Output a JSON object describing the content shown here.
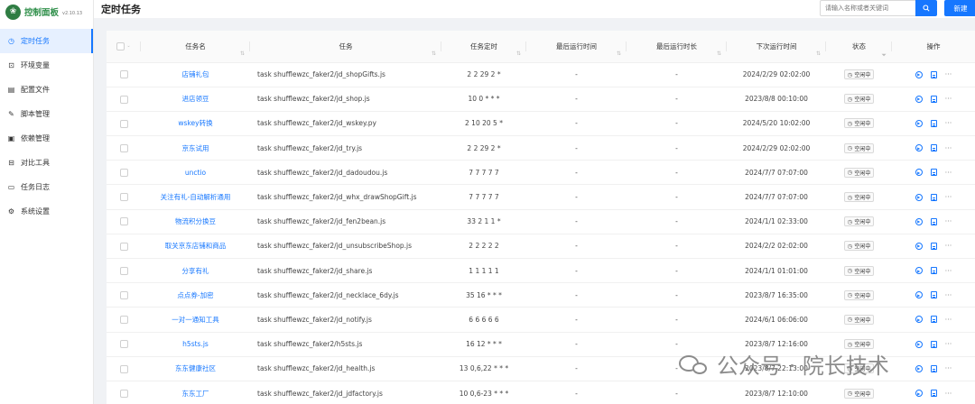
{
  "app": {
    "logo_text": "控制面板",
    "version": "v2.10.13"
  },
  "sidebar": {
    "items": [
      {
        "label": "定时任务",
        "icon": "clock-icon",
        "active": true
      },
      {
        "label": "环境变量",
        "icon": "variable-icon",
        "active": false
      },
      {
        "label": "配置文件",
        "icon": "config-file-icon",
        "active": false
      },
      {
        "label": "脚本管理",
        "icon": "edit-icon",
        "active": false
      },
      {
        "label": "依赖管理",
        "icon": "dependency-icon",
        "active": false
      },
      {
        "label": "对比工具",
        "icon": "diff-icon",
        "active": false
      },
      {
        "label": "任务日志",
        "icon": "folder-icon",
        "active": false
      },
      {
        "label": "系统设置",
        "icon": "gear-icon",
        "active": false
      }
    ]
  },
  "header": {
    "title": "定时任务",
    "search_placeholder": "请输入名称或者关键词",
    "new_label": "新建"
  },
  "table": {
    "columns": [
      "任务名",
      "任务",
      "任务定时",
      "最后运行时间",
      "最后运行时长",
      "下次运行时间",
      "状态",
      "操作"
    ],
    "rows": [
      {
        "name": "店铺礼包",
        "command": "task shufflewzc_faker2/jd_shopGifts.js",
        "schedule": "2 2 29 2 *",
        "last_run": "-",
        "duration": "-",
        "next_run": "2024/2/29 02:02:00",
        "status": "空闲中"
      },
      {
        "name": "进店领豆",
        "command": "task shufflewzc_faker2/jd_shop.js",
        "schedule": "10 0 * * *",
        "last_run": "-",
        "duration": "-",
        "next_run": "2023/8/8 00:10:00",
        "status": "空闲中"
      },
      {
        "name": "wskey转换",
        "command": "task shufflewzc_faker2/jd_wskey.py",
        "schedule": "2 10 20 5 *",
        "last_run": "-",
        "duration": "-",
        "next_run": "2024/5/20 10:02:00",
        "status": "空闲中"
      },
      {
        "name": "京东试用",
        "command": "task shufflewzc_faker2/jd_try.js",
        "schedule": "2 2 29 2 *",
        "last_run": "-",
        "duration": "-",
        "next_run": "2024/2/29 02:02:00",
        "status": "空闲中"
      },
      {
        "name": "unctio",
        "command": "task shufflewzc_faker2/jd_dadoudou.js",
        "schedule": "7 7 7 7 7",
        "last_run": "-",
        "duration": "-",
        "next_run": "2024/7/7 07:07:00",
        "status": "空闲中"
      },
      {
        "name": "关注有礼-自动解析通用",
        "command": "task shufflewzc_faker2/jd_whx_drawShopGift.js",
        "schedule": "7 7 7 7 7",
        "last_run": "-",
        "duration": "-",
        "next_run": "2024/7/7 07:07:00",
        "status": "空闲中"
      },
      {
        "name": "物流积分换豆",
        "command": "task shufflewzc_faker2/jd_fen2bean.js",
        "schedule": "33 2 1 1 *",
        "last_run": "-",
        "duration": "-",
        "next_run": "2024/1/1 02:33:00",
        "status": "空闲中"
      },
      {
        "name": "取关京东店铺和商品",
        "command": "task shufflewzc_faker2/jd_unsubscribeShop.js",
        "schedule": "2 2 2 2 2",
        "last_run": "-",
        "duration": "-",
        "next_run": "2024/2/2 02:02:00",
        "status": "空闲中"
      },
      {
        "name": "分享有礼",
        "command": "task shufflewzc_faker2/jd_share.js",
        "schedule": "1 1 1 1 1",
        "last_run": "-",
        "duration": "-",
        "next_run": "2024/1/1 01:01:00",
        "status": "空闲中"
      },
      {
        "name": "点点券-加密",
        "command": "task shufflewzc_faker2/jd_necklace_6dy.js",
        "schedule": "35 16 * * *",
        "last_run": "-",
        "duration": "-",
        "next_run": "2023/8/7 16:35:00",
        "status": "空闲中"
      },
      {
        "name": "一对一通知工具",
        "command": "task shufflewzc_faker2/jd_notify.js",
        "schedule": "6 6 6 6 6",
        "last_run": "-",
        "duration": "-",
        "next_run": "2024/6/1 06:06:00",
        "status": "空闲中"
      },
      {
        "name": "h5sts.js",
        "command": "task shufflewzc_faker2/h5sts.js",
        "schedule": "16 12 * * *",
        "last_run": "-",
        "duration": "-",
        "next_run": "2023/8/7 12:16:00",
        "status": "空闲中"
      },
      {
        "name": "东东健康社区",
        "command": "task shufflewzc_faker2/jd_health.js",
        "schedule": "13 0,6,22 * * *",
        "last_run": "-",
        "duration": "-",
        "next_run": "2023/8/7 22:13:00",
        "status": "空闲中"
      },
      {
        "name": "东东工厂",
        "command": "task shufflewzc_faker2/jd_jdfactory.js",
        "schedule": "10 0,6-23 * * *",
        "last_run": "-",
        "duration": "-",
        "next_run": "2023/8/7 12:10:00",
        "status": "空闲中"
      }
    ]
  },
  "watermark": {
    "text": "公众号 · 院长技术"
  },
  "colors": {
    "accent": "#1677ff",
    "logo_green": "#2f8f4a",
    "active_bg": "#e6f0ff"
  }
}
